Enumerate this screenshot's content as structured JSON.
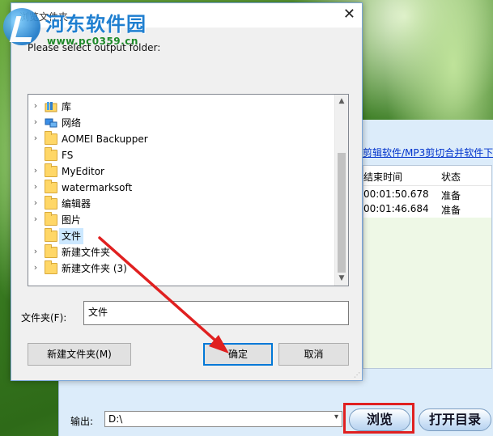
{
  "watermark": {
    "title": "河东软件园",
    "url": "www.pc0359.cn"
  },
  "dialog": {
    "title": "浏览文件夹",
    "close_glyph": "✕",
    "prompt": "Please select output folder:",
    "tree": [
      {
        "label": "库",
        "icon": "library-icon",
        "expandable": true
      },
      {
        "label": "网络",
        "icon": "network-icon",
        "expandable": true
      },
      {
        "label": "AOMEI Backupper",
        "icon": "folder-icon",
        "expandable": true
      },
      {
        "label": "FS",
        "icon": "folder-icon",
        "expandable": false
      },
      {
        "label": "MyEditor",
        "icon": "folder-icon",
        "expandable": true
      },
      {
        "label": "watermarksoft",
        "icon": "folder-icon",
        "expandable": true
      },
      {
        "label": "编辑器",
        "icon": "folder-icon",
        "expandable": true
      },
      {
        "label": "图片",
        "icon": "folder-icon",
        "expandable": true
      },
      {
        "label": "文件",
        "icon": "folder-icon",
        "expandable": false,
        "selected": true
      },
      {
        "label": "新建文件夹",
        "icon": "folder-icon",
        "expandable": true
      },
      {
        "label": "新建文件夹 (3)",
        "icon": "folder-icon",
        "expandable": true
      }
    ],
    "folder_label": "文件夹(F):",
    "folder_value": "文件",
    "new_folder_button": "新建文件夹(M)",
    "ok_button": "确定",
    "cancel_button": "取消"
  },
  "app": {
    "link_text": "剪辑软件/MP3剪切合并软件下",
    "columns": [
      "结束时间",
      "状态"
    ],
    "rows": [
      {
        "end": "00:01:50.678",
        "status": "准备"
      },
      {
        "end": "00:01:46.684",
        "status": "准备"
      }
    ],
    "output_label": "输出:",
    "output_value": "D:\\",
    "browse_button": "浏览",
    "open_dir_button": "打开目录"
  },
  "colors": {
    "annotation_red": "#e02020",
    "selection_blue": "#cce8ff",
    "focus_blue": "#0078d7"
  }
}
